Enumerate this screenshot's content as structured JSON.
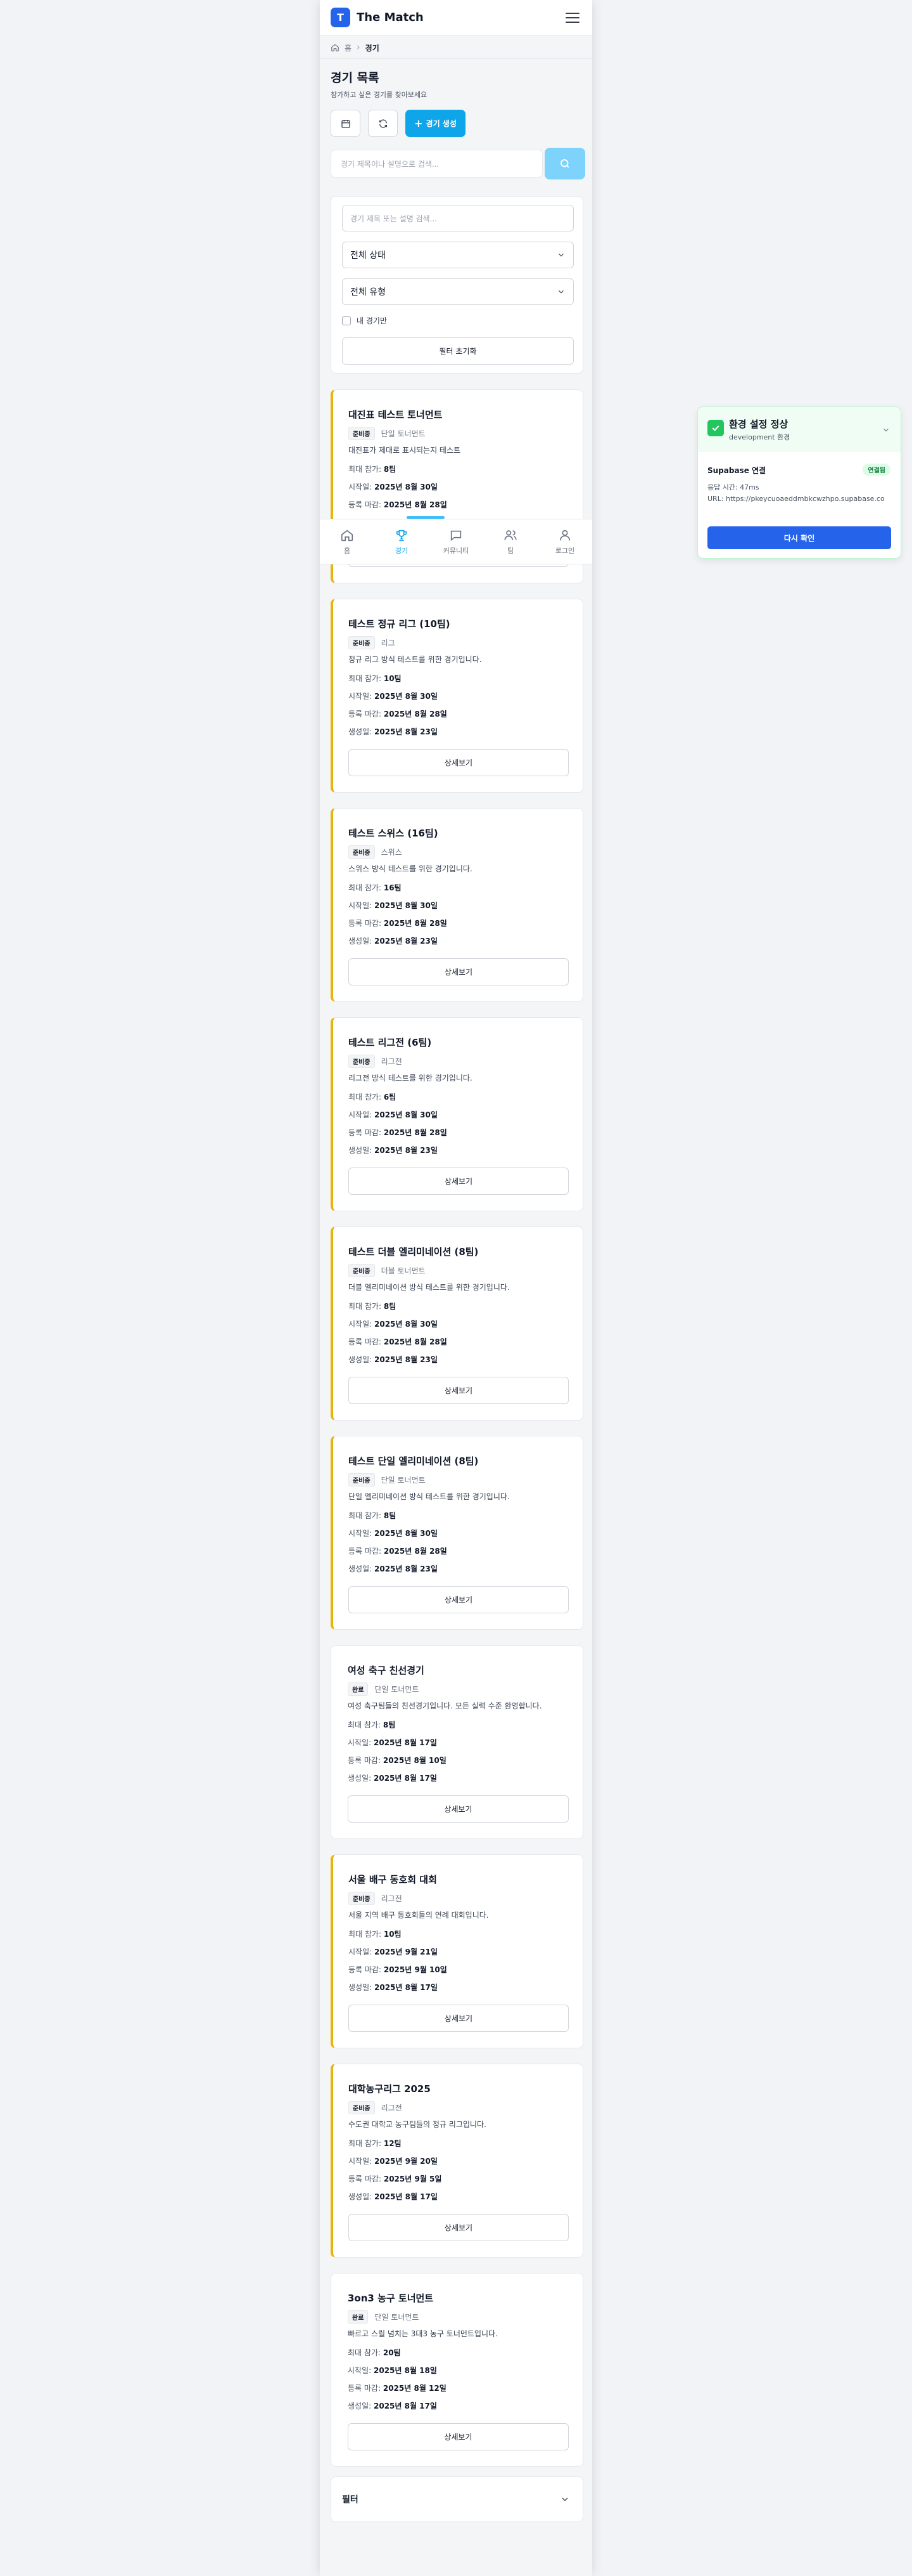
{
  "header": {
    "logo_letter": "T",
    "brand": "The Match"
  },
  "breadcrumb": {
    "home": "홈",
    "current": "경기"
  },
  "page": {
    "title": "경기 목록",
    "subtitle": "참가하고 싶은 경기를 찾아보세요"
  },
  "toolbar": {
    "create_label": "경기 생성"
  },
  "search": {
    "placeholder": "경기 제목이나 설명으로 검색..."
  },
  "filters": {
    "input_placeholder": "경기 제목 또는 설명 검색...",
    "status_select": "전체 상태",
    "type_select": "전체 유형",
    "my_matches_label": "내 경기만",
    "reset_label": "필터 초기화"
  },
  "labels": {
    "max_participants": "최대 참가:",
    "start_date": "시작일:",
    "registration_deadline": "등록 마감:",
    "created_date": "생성일:",
    "detail_button": "상세보기"
  },
  "matches": [
    {
      "title": "대진표 테스트 토너먼트",
      "status": "준비중",
      "type": "단일 토너먼트",
      "description": "대진표가 제대로 표시되는지 테스트",
      "max": "8팀",
      "start": "2025년 8월 30일",
      "deadline": "2025년 8월 28일",
      "created": ""
    },
    {
      "title": "테스트 정규 리그 (10팀)",
      "status": "준비중",
      "type": "리그",
      "description": "정규 리그 방식 테스트를 위한 경기입니다.",
      "max": "10팀",
      "start": "2025년 8월 30일",
      "deadline": "2025년 8월 28일",
      "created": "2025년 8월 23일"
    },
    {
      "title": "테스트 스위스 (16팀)",
      "status": "준비중",
      "type": "스위스",
      "description": "스위스 방식 테스트를 위한 경기입니다.",
      "max": "16팀",
      "start": "2025년 8월 30일",
      "deadline": "2025년 8월 28일",
      "created": "2025년 8월 23일"
    },
    {
      "title": "테스트 리그전 (6팀)",
      "status": "준비중",
      "type": "리그전",
      "description": "리그전 방식 테스트를 위한 경기입니다.",
      "max": "6팀",
      "start": "2025년 8월 30일",
      "deadline": "2025년 8월 28일",
      "created": "2025년 8월 23일"
    },
    {
      "title": "테스트 더블 엘리미네이션 (8팀)",
      "status": "준비중",
      "type": "더블 토너먼트",
      "description": "더블 엘리미네이션 방식 테스트를 위한 경기입니다.",
      "max": "8팀",
      "start": "2025년 8월 30일",
      "deadline": "2025년 8월 28일",
      "created": "2025년 8월 23일"
    },
    {
      "title": "테스트 단일 엘리미네이션 (8팀)",
      "status": "준비중",
      "type": "단일 토너먼트",
      "description": "단일 엘리미네이션 방식 테스트를 위한 경기입니다.",
      "max": "8팀",
      "start": "2025년 8월 30일",
      "deadline": "2025년 8월 28일",
      "created": "2025년 8월 23일"
    },
    {
      "title": "여성 축구 친선경기",
      "status": "완료",
      "type": "단일 토너먼트",
      "description": "여성 축구팀들의 친선경기입니다. 모든 실력 수준 환영합니다.",
      "max": "8팀",
      "start": "2025년 8월 17일",
      "deadline": "2025년 8월 10일",
      "created": "2025년 8월 17일"
    },
    {
      "title": "서울 배구 동호회 대회",
      "status": "준비중",
      "type": "리그전",
      "description": "서울 지역 배구 동호회들의 연례 대회입니다.",
      "max": "10팀",
      "start": "2025년 9월 21일",
      "deadline": "2025년 9월 10일",
      "created": "2025년 8월 17일"
    },
    {
      "title": "대학농구리그 2025",
      "status": "준비중",
      "type": "리그전",
      "description": "수도권 대학교 농구팀들의 정규 리그입니다.",
      "max": "12팀",
      "start": "2025년 9월 20일",
      "deadline": "2025년 9월 5일",
      "created": "2025년 8월 17일"
    },
    {
      "title": "3on3 농구 토너먼트",
      "status": "완료",
      "type": "단일 토너먼트",
      "description": "빠르고 스릴 넘치는 3대3 농구 토너먼트입니다.",
      "max": "20팀",
      "start": "2025년 8월 18일",
      "deadline": "2025년 8월 12일",
      "created": "2025년 8월 17일"
    }
  ],
  "bottom_nav": [
    {
      "label": "홈",
      "icon": "home-icon"
    },
    {
      "label": "경기",
      "icon": "trophy-icon"
    },
    {
      "label": "커뮤니티",
      "icon": "chat-icon"
    },
    {
      "label": "팀",
      "icon": "users-icon"
    },
    {
      "label": "로그인",
      "icon": "user-icon"
    }
  ],
  "filter_footer": {
    "label": "필터"
  },
  "env_panel": {
    "title": "환경 설정 정상",
    "subtitle": "development 환경",
    "connection_label": "Supabase 연결",
    "connection_status": "연결됨",
    "response_time": "응답 시간: 47ms",
    "url": "URL: https://pkeycuoaeddmbkcwzhpo.supabase.co",
    "recheck_label": "다시 확인"
  },
  "colors": {
    "primary": "#2563eb",
    "accent": "#0ea5e9",
    "prep_bar": "#eab308",
    "env_ok": "#22c55e"
  }
}
